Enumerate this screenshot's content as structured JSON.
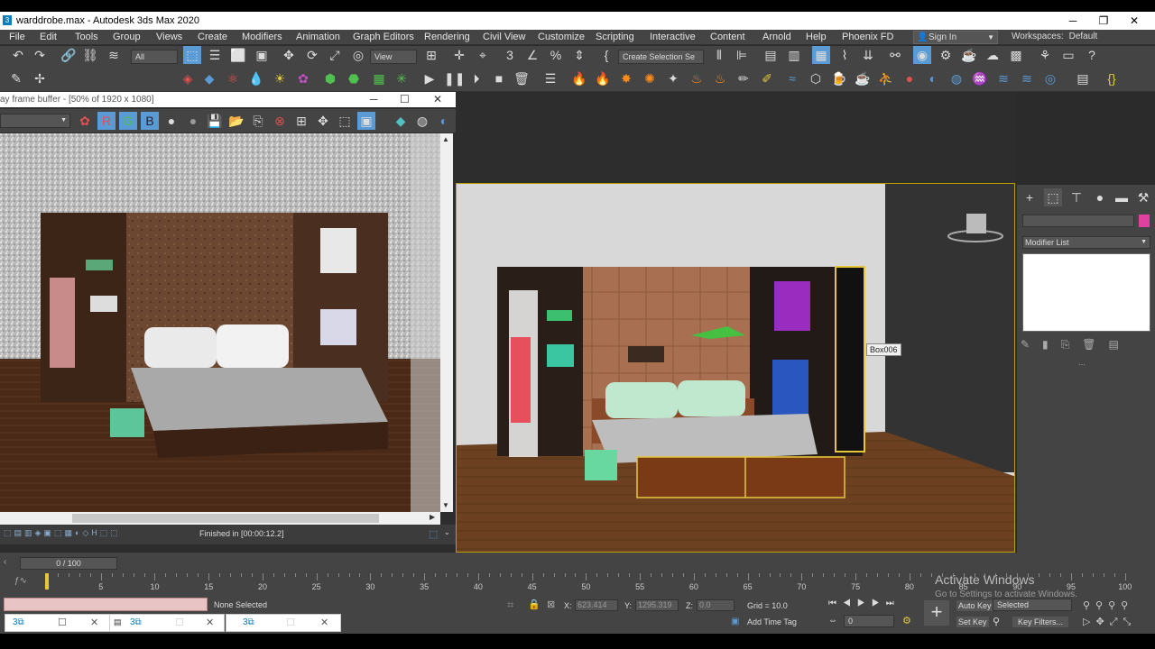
{
  "window": {
    "title": "warddrobe.max - Autodesk 3ds Max 2020",
    "minimize": "─",
    "restore": "❐",
    "close": "✕"
  },
  "menu": [
    "File",
    "Edit",
    "Tools",
    "Group",
    "Views",
    "Create",
    "Modifiers",
    "Animation",
    "Graph Editors",
    "Rendering",
    "Civil View",
    "Customize",
    "Scripting",
    "Interactive",
    "Content",
    "Arnold",
    "Help",
    "Phoenix FD"
  ],
  "account": {
    "signin": "Sign In",
    "workspaces_label": "Workspaces:",
    "workspace": "Default"
  },
  "toolbar": {
    "filter": "All",
    "refcoord": "View",
    "selection_set": "Create Selection Se"
  },
  "vfb": {
    "title": "ay frame buffer - [50% of 1920 x 1080]",
    "status": "Finished in [00:00:12.2]",
    "minimize": "─",
    "restore": "☐",
    "close": "✕",
    "channel_btns": [
      "R",
      "G",
      "B"
    ]
  },
  "viewport": {
    "object_label": "Box006"
  },
  "command_panel": {
    "modifier_list": "Modifier List"
  },
  "timeline": {
    "frame": "0 / 100",
    "ticks": [
      "0",
      "5",
      "10",
      "15",
      "20",
      "25",
      "30",
      "35",
      "40",
      "45",
      "50",
      "55",
      "60",
      "65",
      "70",
      "75",
      "80",
      "85",
      "90",
      "95",
      "100"
    ]
  },
  "status": {
    "selection": "None Selected",
    "x_label": "X:",
    "x_value": "623.414",
    "y_label": "Y:",
    "y_value": "1295.319",
    "z_label": "Z:",
    "z_value": "0.0",
    "grid": "Grid = 10.0",
    "add_time_tag": "Add Time Tag",
    "auto_key": "Auto Key",
    "selected": "Selected",
    "set_key": "Set Key",
    "key_filters": "Key Filters...",
    "frame_field": "0"
  },
  "watermark": {
    "line1": "Activate Windows",
    "line2": "Go to Settings to activate Windows."
  },
  "colors": {
    "accent": "#5b9bd5",
    "selection": "#e5c83a",
    "bg": "#444444"
  }
}
